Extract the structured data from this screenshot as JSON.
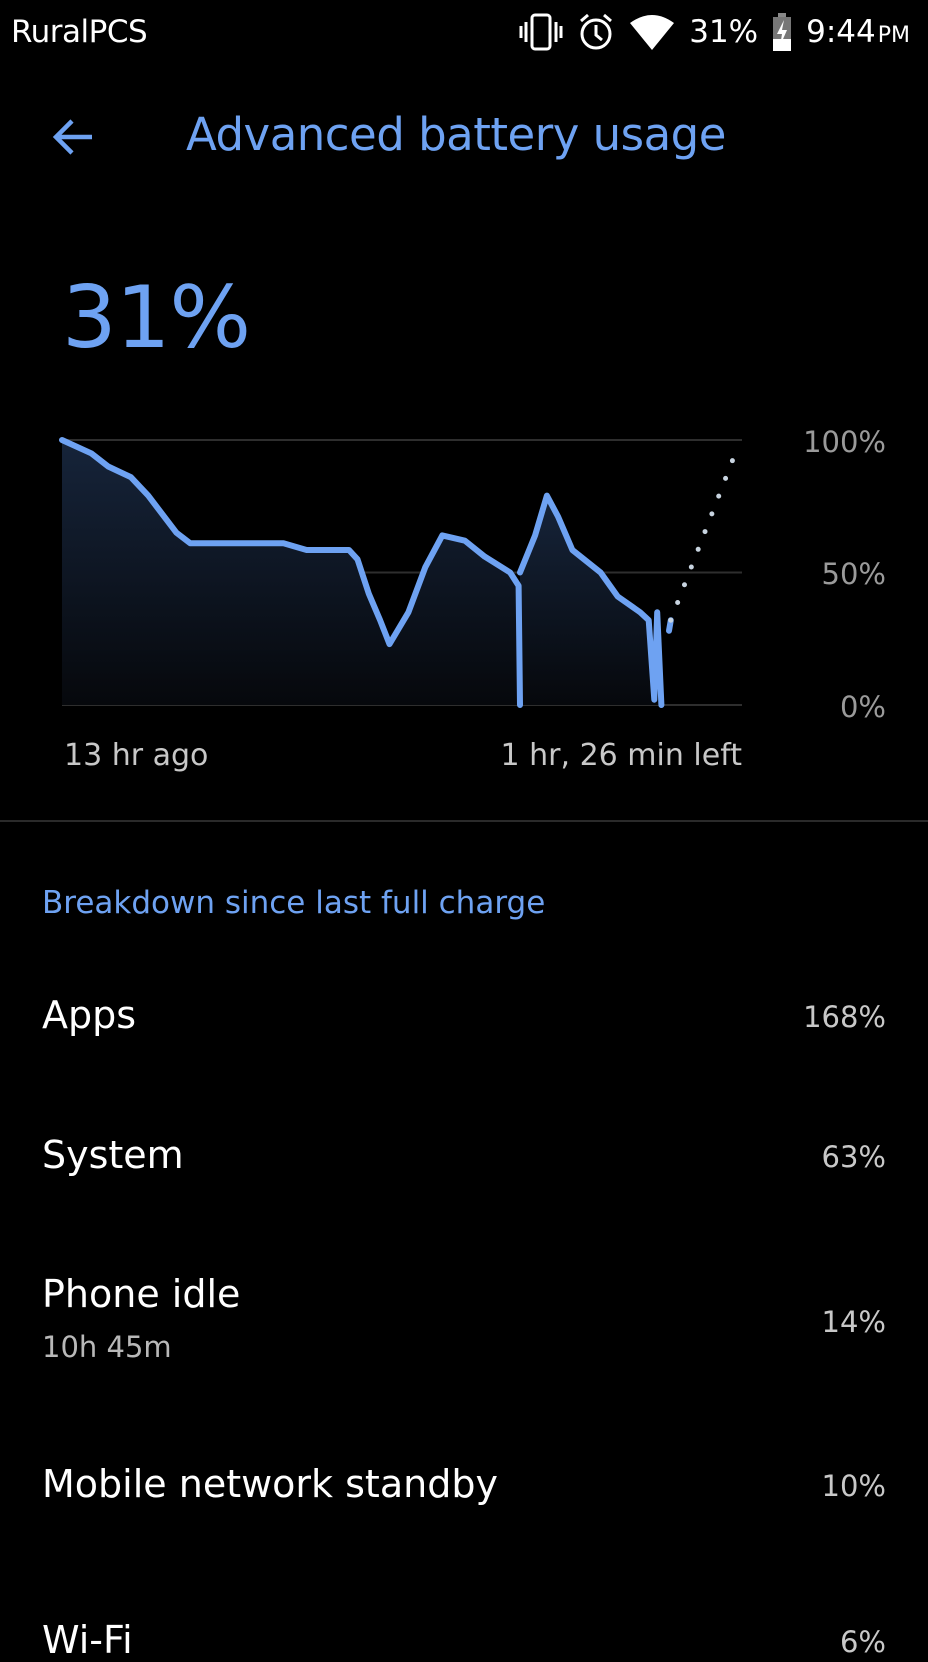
{
  "status_bar": {
    "carrier": "RuralPCS",
    "battery_percent": "31%",
    "time": "9:44",
    "ampm": "PM",
    "icons": [
      "vibrate-icon",
      "alarm-icon",
      "wifi-icon",
      "battery-charging-icon"
    ]
  },
  "header": {
    "title": "Advanced battery usage",
    "back_icon": "arrow-left-icon"
  },
  "battery_level": "31%",
  "accent_color": "#6ea2f2",
  "chart_data": {
    "type": "line",
    "xlabel": "",
    "ylabel": "",
    "x_tick_labels": [
      "13 hr ago",
      "1 hr, 26 min left"
    ],
    "y_tick_labels": [
      "100%",
      "50%",
      "0%"
    ],
    "ylim": [
      0,
      100
    ],
    "x_unit": "hours ago",
    "xlim": [
      13,
      -1.43
    ],
    "grid": true,
    "series": [
      {
        "style": "solid",
        "points": [
          [
            13.0,
            100
          ],
          [
            12.38,
            95
          ],
          [
            12.02,
            90
          ],
          [
            11.54,
            86
          ],
          [
            11.17,
            79
          ],
          [
            10.57,
            65
          ],
          [
            10.28,
            61
          ],
          [
            8.3,
            61
          ],
          [
            7.81,
            58.5
          ],
          [
            6.91,
            58.5
          ],
          [
            6.73,
            55
          ],
          [
            6.49,
            42
          ],
          [
            6.25,
            32
          ],
          [
            6.05,
            23
          ],
          [
            5.65,
            35
          ],
          [
            5.29,
            52
          ],
          [
            4.93,
            64
          ],
          [
            4.45,
            62
          ],
          [
            4.03,
            56
          ],
          [
            3.49,
            50
          ],
          [
            3.31,
            45
          ],
          [
            3.28,
            0
          ]
        ]
      },
      {
        "style": "solid",
        "points": [
          [
            3.28,
            50
          ],
          [
            2.96,
            64
          ],
          [
            2.71,
            79
          ],
          [
            2.47,
            71
          ],
          [
            2.17,
            58.5
          ],
          [
            1.57,
            50
          ],
          [
            1.21,
            41
          ],
          [
            0.73,
            35
          ],
          [
            0.55,
            32
          ],
          [
            0.43,
            2
          ],
          [
            0.37,
            35
          ],
          [
            0.28,
            0
          ]
        ]
      },
      {
        "style": "solid",
        "points": [
          [
            0.12,
            28
          ],
          [
            0.08,
            32
          ]
        ]
      },
      {
        "style": "dotted",
        "points": [
          [
            0.08,
            32
          ],
          [
            -1.31,
            96
          ]
        ]
      }
    ]
  },
  "breakdown": {
    "heading": "Breakdown since last full charge",
    "rows": [
      {
        "label": "Apps",
        "value": "168%"
      },
      {
        "label": "System",
        "value": "63%"
      },
      {
        "label": "Phone idle",
        "sub": "10h 45m",
        "value": "14%"
      },
      {
        "label": "Mobile network standby",
        "value": "10%"
      },
      {
        "label": "Wi-Fi",
        "value": "6%"
      }
    ]
  }
}
